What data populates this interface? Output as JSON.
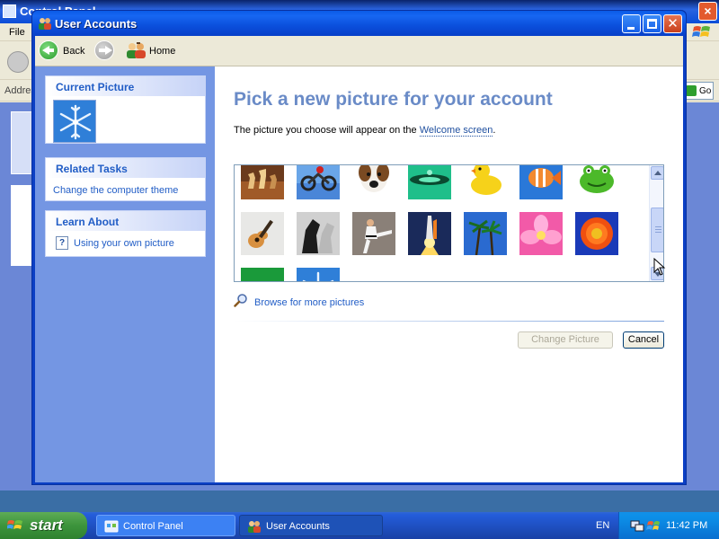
{
  "background_window": {
    "title": "Control Panel",
    "menu_file": "File",
    "address_label": "Addres",
    "go_label": "Go"
  },
  "window": {
    "title": "User Accounts"
  },
  "nav": {
    "back_label": "Back",
    "home_label": "Home"
  },
  "sidebar": {
    "current_picture_heading": "Current Picture",
    "related_tasks_heading": "Related Tasks",
    "related_tasks": [
      "Change the computer theme"
    ],
    "learn_about_heading": "Learn About",
    "learn_about": [
      "Using your own picture"
    ]
  },
  "main": {
    "heading": "Pick a new picture for your account",
    "description_prefix": "The picture you choose will appear on the ",
    "description_link": "Welcome screen",
    "description_suffix": ".",
    "pictures": [
      "chess",
      "dirt-bike",
      "dog",
      "drip",
      "duck",
      "fish",
      "frog",
      "guitar",
      "horses",
      "karate",
      "space-shuttle",
      "palm-trees",
      "flower-pink",
      "flower-orange",
      "green",
      "snowflake"
    ],
    "browse_label": "Browse for more pictures",
    "change_button": "Change Picture",
    "cancel_button": "Cancel"
  },
  "taskbar": {
    "start_label": "start",
    "tasks": [
      "Control Panel",
      "User Accounts"
    ],
    "active_task": "User Accounts",
    "language": "EN",
    "clock": "11:42 PM"
  },
  "colors": {
    "xp_blue": "#0b4fdc",
    "sidebar_blue": "#7496e3",
    "heading_blue": "#6a8bc7",
    "link_blue": "#215dc6"
  }
}
